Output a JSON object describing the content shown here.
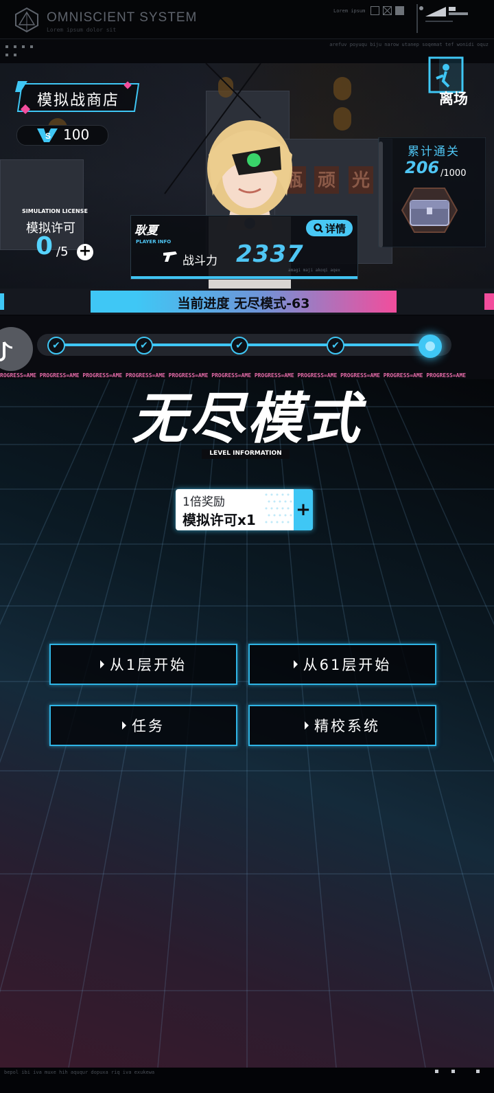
{
  "system": {
    "title": "OMNISCIENT SYSTEM",
    "subtitle": "Lorem ipsum dolor sit",
    "top_lorem": "Lorem ipsum",
    "ticker_top": "arefuv poyuqu biju narow utanep soqemat tef wonidi oquz",
    "ticker_strip": "ROGRESS=AME PROGRESS=AME PROGRESS=AME PROGRESS=AME PROGRESS=AME PROGRESS=AME PROGRESS=AME PROGRESS=AME PROGRESS=AME PROGRESS=AME PROGRESS=AME",
    "bottom_ticker": "bepol ibi iva muxe hih aququr dopuxa riq iva exukewa"
  },
  "shop": {
    "label": "模拟战商店"
  },
  "currency": {
    "icon": "vs-icon",
    "value": "100"
  },
  "exit": {
    "label": "离场",
    "icon": "exit-door-icon"
  },
  "license": {
    "label_en": "SIMULATION LICENSE",
    "label": "模拟许可",
    "current": "0",
    "max": "/5",
    "add": "+"
  },
  "clear": {
    "label": "累计通关",
    "current": "206",
    "max": "/1000",
    "icon": "treasure-chest-icon"
  },
  "player": {
    "name": "耿夏",
    "info_en": "PLAYER INFO",
    "detail_label": "详情",
    "power_label": "战斗力",
    "power_value": "2337",
    "tiny": "amagi maji akoqi aqex"
  },
  "progress": {
    "banner": "当前进度 无尽模式-63",
    "nodes": [
      "✔",
      "✔",
      "✔",
      "✔"
    ],
    "fraction": 1.0
  },
  "mode": {
    "title": "无尽模式",
    "subtitle_en": "LEVEL INFORMATION"
  },
  "reward": {
    "multiplier": "1倍奖励",
    "item": "模拟许可x1",
    "add": "+"
  },
  "menu": {
    "start1": "从1层开始",
    "start61": "从61层开始",
    "task": "任务",
    "calib": "精校系统"
  },
  "colors": {
    "accent_blue": "#3fc7f5",
    "accent_pink": "#f24d9c",
    "background": "#07080c"
  }
}
